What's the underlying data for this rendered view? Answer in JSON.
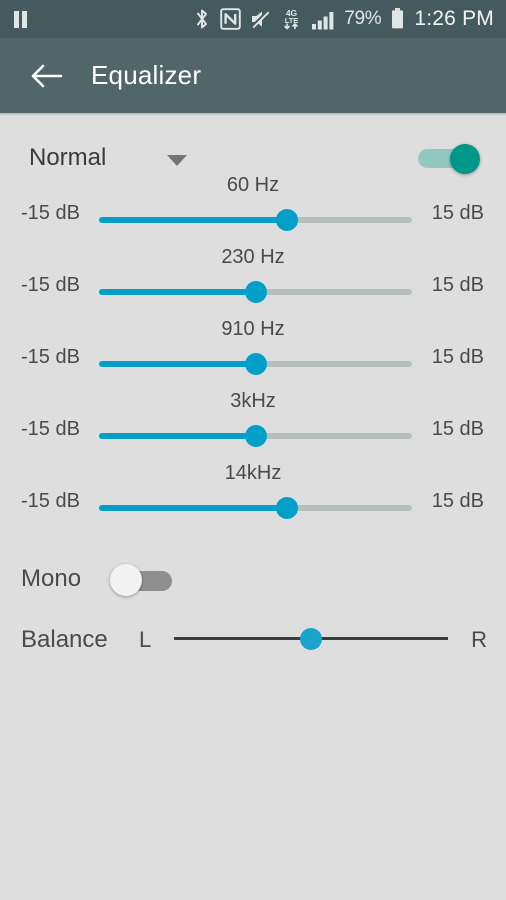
{
  "status_bar": {
    "media_icon": "pause-icon",
    "icons": [
      "bluetooth-icon",
      "nfc-icon",
      "mute-icon",
      "4g-lte-icon",
      "signal-bars-icon"
    ],
    "lte_label_top": "4G",
    "lte_label_bottom": "LTE",
    "battery_percent": "79%",
    "battery_icon": "battery-icon",
    "time": "1:26 PM",
    "background_color": "#455a5f"
  },
  "app_bar": {
    "back_icon": "arrow-back-icon",
    "title": "Equalizer",
    "background_color": "#51666b"
  },
  "preset": {
    "selected": "Normal",
    "caret_icon": "chevron-down-icon",
    "enabled": true,
    "switch_on_color": "#009688",
    "switch_track_color": "#93c9c0"
  },
  "equalizer": {
    "min_label": "-15 dB",
    "max_label": "15 dB",
    "accent_color": "#039fc8",
    "rail_color": "#b7bfbd",
    "bands": [
      {
        "freq": "60 Hz",
        "percent": 60
      },
      {
        "freq": "230 Hz",
        "percent": 50
      },
      {
        "freq": "910 Hz",
        "percent": 50
      },
      {
        "freq": "3kHz",
        "percent": 50
      },
      {
        "freq": "14kHz",
        "percent": 60
      }
    ]
  },
  "mono": {
    "label": "Mono",
    "enabled": false,
    "track_color": "#8f8f8f",
    "thumb_color": "#f2f2f2"
  },
  "balance": {
    "label": "Balance",
    "left_label": "L",
    "right_label": "R",
    "percent": 50,
    "knob_color": "#1aa3cc",
    "rail_color": "#3c3c3c"
  },
  "page": {
    "background_color": "#dedede"
  }
}
